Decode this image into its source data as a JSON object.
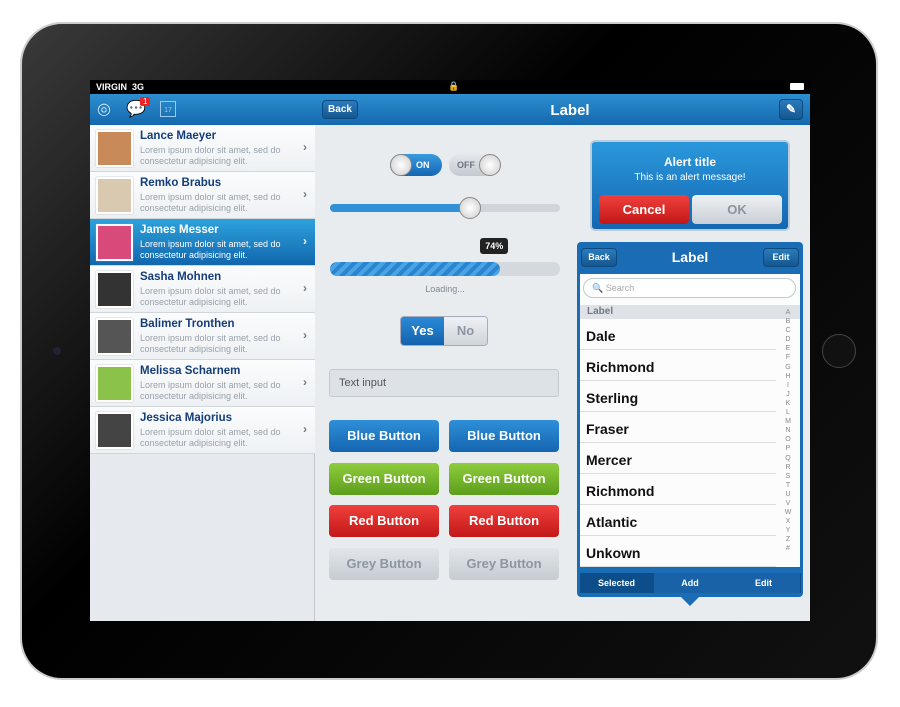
{
  "status": {
    "carrier": "VIRGIN",
    "network": "3G"
  },
  "topbar": {
    "back": "Back",
    "title": "Label",
    "badge": "1",
    "calendar_day": "17",
    "icons": [
      "lifebuoy-icon",
      "chat-icon",
      "calendar-icon",
      "compose-icon"
    ]
  },
  "contacts": [
    {
      "name": "Lance Maeyer",
      "desc": "Lorem ipsum dolor sit amet, sed do consectetur adipisicing elit.",
      "selected": false
    },
    {
      "name": "Remko Brabus",
      "desc": "Lorem ipsum dolor sit amet, sed do consectetur adipisicing elit.",
      "selected": false
    },
    {
      "name": "James Messer",
      "desc": "Lorem ipsum dolor sit amet, sed do consectetur adipisicing elit.",
      "selected": true
    },
    {
      "name": "Sasha Mohnen",
      "desc": "Lorem ipsum dolor sit amet, sed do consectetur adipisicing elit.",
      "selected": false
    },
    {
      "name": "Balimer Tronthen",
      "desc": "Lorem ipsum dolor sit amet, sed do consectetur adipisicing elit.",
      "selected": false
    },
    {
      "name": "Melissa Scharnem",
      "desc": "Lorem ipsum dolor sit amet, sed do consectetur adipisicing elit.",
      "selected": false
    },
    {
      "name": "Jessica Majorius",
      "desc": "Lorem ipsum dolor sit amet, sed do consectetur adipisicing elit.",
      "selected": false
    }
  ],
  "controls": {
    "toggle_on": "ON",
    "toggle_off": "OFF",
    "slider_value": 0.61,
    "progress_label": "74%",
    "progress": 0.74,
    "loading": "Loading...",
    "seg_yes": "Yes",
    "seg_no": "No",
    "text_input": "Text input",
    "buttons": [
      "Blue Button",
      "Green Button",
      "Red Button",
      "Grey Button"
    ]
  },
  "alert": {
    "title": "Alert title",
    "message": "This is an alert message!",
    "cancel": "Cancel",
    "ok": "OK"
  },
  "popover": {
    "back": "Back",
    "title": "Label",
    "edit": "Edit",
    "search_placeholder": "Search",
    "section": "Label",
    "items": [
      "Dale",
      "Richmond",
      "Sterling",
      "Fraser",
      "Mercer",
      "Richmond",
      "Atlantic",
      "Unkown"
    ],
    "index": [
      "A",
      "B",
      "C",
      "D",
      "E",
      "F",
      "G",
      "H",
      "I",
      "J",
      "K",
      "L",
      "M",
      "N",
      "O",
      "P",
      "Q",
      "R",
      "S",
      "T",
      "U",
      "V",
      "W",
      "X",
      "Y",
      "Z",
      "#"
    ],
    "tabs": [
      "Selected",
      "Add",
      "Edit"
    ]
  }
}
